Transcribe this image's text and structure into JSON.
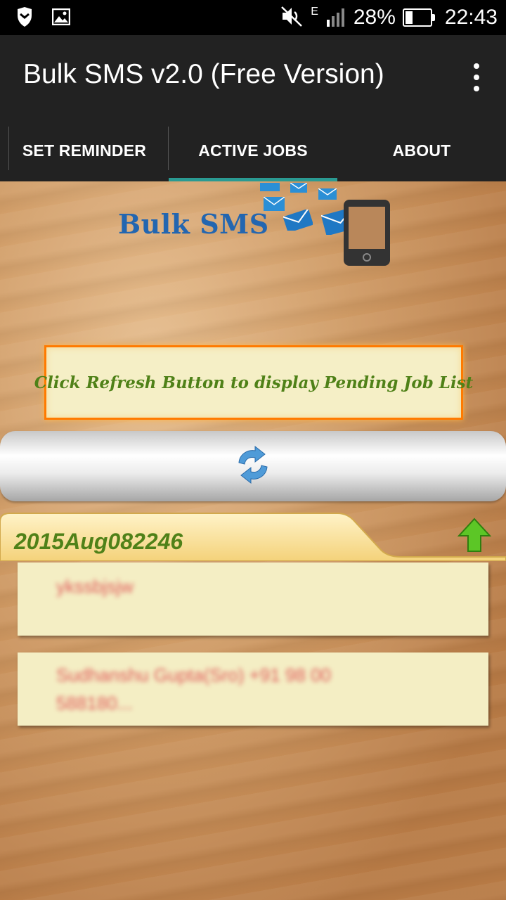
{
  "status_bar": {
    "battery": "28%",
    "battery_level": 0.28,
    "network": "E",
    "time": "22:43",
    "icons": [
      "shield-icon",
      "image-icon",
      "mute-icon",
      "signal-icon",
      "battery-icon"
    ]
  },
  "app_bar": {
    "title": "Bulk SMS v2.0 (Free Version)",
    "menu_icon": "overflow-menu-icon"
  },
  "tabs": [
    {
      "label": "SET REMINDER",
      "active": false
    },
    {
      "label": "ACTIVE JOBS",
      "active": true
    },
    {
      "label": "ABOUT",
      "active": false
    }
  ],
  "logo": {
    "text": "Bulk SMS",
    "icons": [
      "envelope-icon",
      "phone-icon"
    ]
  },
  "notice": {
    "text": "Click Refresh Button to display Pending Job List"
  },
  "refresh": {
    "icon": "refresh-icon"
  },
  "job": {
    "title": "2015Aug082246",
    "collapse_icon": "arrow-up-icon",
    "message": "ykssbjsjw",
    "recipients_line1": "Sudhanshu Gupta(Sro) +91 98 00",
    "recipients_line2": "588180..."
  },
  "colors": {
    "accent": "#2a9a92",
    "notice_border": "#ff7a00",
    "green_text": "#4f8118",
    "logo_blue": "#2366b0"
  }
}
